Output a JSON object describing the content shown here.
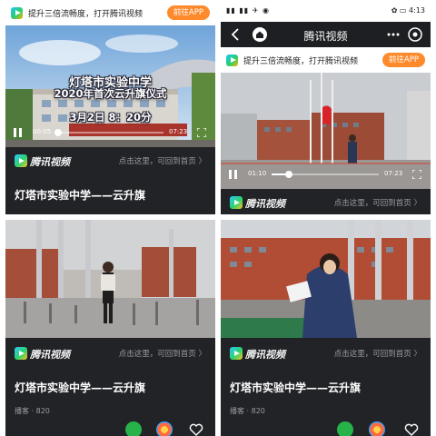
{
  "promo": {
    "text": "提升三倍流畅度，打开腾讯视频",
    "button": "前往APP"
  },
  "status_bar": {
    "left": "▮▮ ▮▮ ✈ ◉",
    "right": "✿ ▭ 4:13"
  },
  "navbar": {
    "title": "腾讯视频"
  },
  "panels": [
    {
      "overlay_line1": "灯塔市实验中学",
      "overlay_line2": "2020年首次云升旗仪式",
      "overlay_line3": "3月2日 8：20分",
      "time_current": "00:05",
      "time_total": "07:23",
      "progress": 0.02,
      "brand": "腾讯视频",
      "back_link": "点击这里，可回到首页 〉",
      "title": "灯塔市实验中学——云升旗"
    },
    {
      "time_current": "01:10",
      "time_total": "07:23",
      "progress": 0.16,
      "brand": "腾讯视频",
      "back_link": "点击这里，可回到首页 〉"
    },
    {
      "brand": "腾讯视频",
      "back_link": "点击这里，可回到首页 〉",
      "title": "灯塔市实验中学——云升旗",
      "meta": "播客 · 820"
    },
    {
      "brand": "腾讯视频",
      "back_link": "点击这里，可回到首页 〉",
      "title": "灯塔市实验中学——云升旗",
      "meta": "播客 · 820"
    }
  ],
  "colors": {
    "page_bg": "#ffffff",
    "panel_bg": "#222327",
    "promo_button": "#ff8a2b",
    "flag_red": "#d8232a"
  },
  "icons": [
    "back-icon",
    "home-icon",
    "target-icon",
    "play-pause-icon",
    "fullscreen-icon",
    "tencent-video-logo-icon",
    "wechat-icon",
    "share-icon",
    "heart-icon"
  ]
}
